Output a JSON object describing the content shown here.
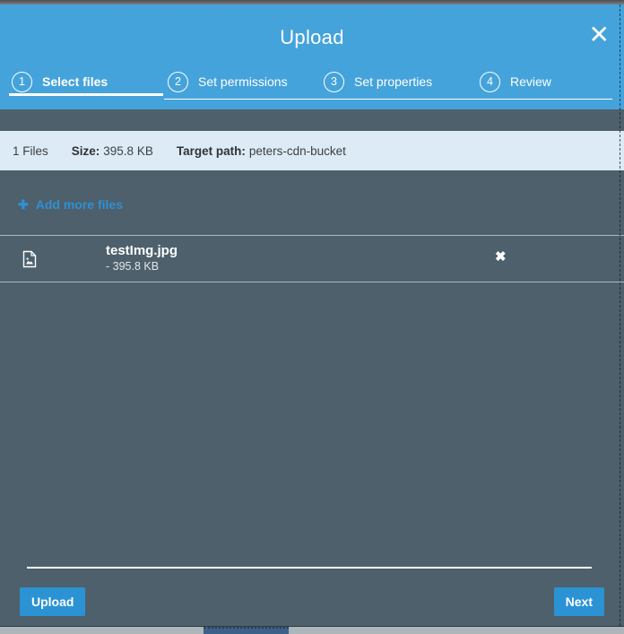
{
  "modal": {
    "title": "Upload",
    "icons": {
      "close": "✕",
      "plus": "✚",
      "remove": "✖"
    },
    "steps": [
      {
        "number": "1",
        "label": "Select files"
      },
      {
        "number": "2",
        "label": "Set permissions"
      },
      {
        "number": "3",
        "label": "Set properties"
      },
      {
        "number": "4",
        "label": "Review"
      }
    ],
    "summary": {
      "file_count": "1 Files",
      "size_label": "Size:",
      "size_value": "395.8 KB",
      "target_label": "Target path:",
      "target_value": "peters-cdn-bucket"
    },
    "add_more_label": "Add more files",
    "files": [
      {
        "name": "testImg.jpg",
        "size": "- 395.8 KB"
      }
    ],
    "footer": {
      "upload_label": "Upload",
      "next_label": "Next"
    }
  },
  "colors": {
    "header_blue": "#45a3db",
    "body_slate": "#4d606b",
    "accent_blue": "#2b93d4",
    "summary_bg": "#dcebf6"
  }
}
